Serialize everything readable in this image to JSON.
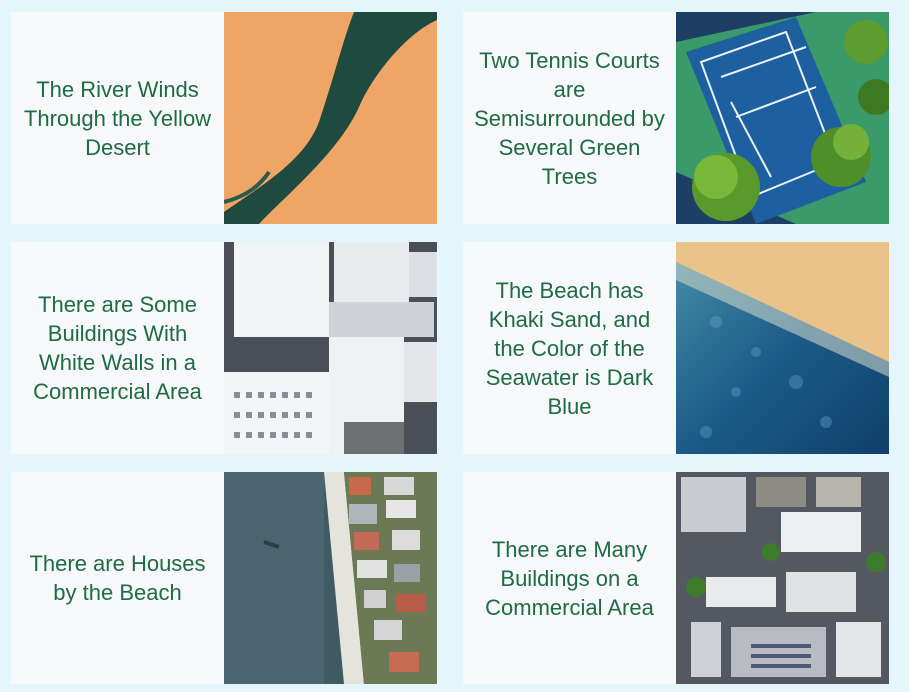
{
  "cards": [
    {
      "caption": "The River Winds Through the Yellow Desert"
    },
    {
      "caption": "Two Tennis Courts are Semisurrounded by Several Green Trees"
    },
    {
      "caption": "There are Some Buildings With White Walls in a Commercial Area"
    },
    {
      "caption": "The Beach has Khaki Sand, and the Color of the Seawater is Dark Blue"
    },
    {
      "caption": "There are Houses by the Beach"
    },
    {
      "caption": "There are Many Buildings on a Commercial Area"
    }
  ],
  "colors": {
    "background": "#e4f5fc",
    "card": "#f6f8fa",
    "caption_text": "#1f6b43",
    "desert": "#f0a868",
    "river": "#1f4a40",
    "court": "#1e5fa0",
    "court_outer": "#3a9a6a",
    "tree": "#4f8f2a",
    "sand": "#e9c38a",
    "sea": "#1c5c88"
  }
}
